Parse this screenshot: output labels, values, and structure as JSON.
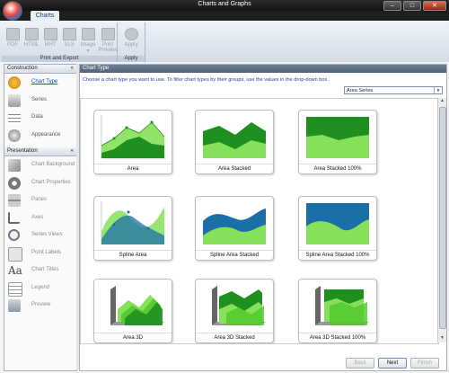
{
  "window": {
    "title": "Charts and Graphs"
  },
  "ribbon": {
    "tab": "Charts",
    "groups": [
      {
        "name": "Print and Export",
        "buttons": [
          "PDF",
          "HTML",
          "MHT",
          "XLS",
          "Image",
          "Print Preview"
        ]
      },
      {
        "name": "Apply",
        "buttons": [
          "Apply"
        ]
      }
    ]
  },
  "sidebar": {
    "construction": {
      "title": "Construction",
      "items": [
        {
          "label": "Chart Type",
          "icon": "chart-type-icon",
          "active": true
        },
        {
          "label": "Series",
          "icon": "series-icon"
        },
        {
          "label": "Data",
          "icon": "data-icon"
        },
        {
          "label": "Appearance",
          "icon": "appearance-icon"
        }
      ]
    },
    "presentation": {
      "title": "Presentation",
      "items": [
        {
          "label": "Chart Background",
          "icon": "background-icon"
        },
        {
          "label": "Chart Properties",
          "icon": "gear-icon"
        },
        {
          "label": "Panes",
          "icon": "panes-icon"
        },
        {
          "label": "Axes",
          "icon": "axes-icon"
        },
        {
          "label": "Series Views",
          "icon": "magnifier-icon"
        },
        {
          "label": "Point Labels",
          "icon": "labels-icon"
        },
        {
          "label": "Chart Titles",
          "icon": "titles-icon"
        },
        {
          "label": "Legend",
          "icon": "legend-icon"
        },
        {
          "label": "Preview",
          "icon": "preview-icon"
        }
      ]
    }
  },
  "content": {
    "header": "Chart Type",
    "instructions": "Choose a chart type you want to use. To filter chart types by their groups, use the values in the drop-down box.",
    "filter": {
      "selected": "Area Series"
    },
    "charts": [
      {
        "label": "Area"
      },
      {
        "label": "Area Stacked"
      },
      {
        "label": "Area Stacked 100%"
      },
      {
        "label": "Spline Area"
      },
      {
        "label": "Spline Area Stacked"
      },
      {
        "label": "Spline Area Stacked 100%"
      },
      {
        "label": "Area 3D"
      },
      {
        "label": "Area 3D Stacked"
      },
      {
        "label": "Area 3D Stacked 100%"
      }
    ]
  },
  "footer": {
    "back": "Back",
    "next": "Next",
    "finish": "Finish"
  },
  "colors": {
    "green_dark": "#1f8f1f",
    "green_light": "#86e05a",
    "blue": "#1b6fa8",
    "accent": "#1a4fb5"
  }
}
